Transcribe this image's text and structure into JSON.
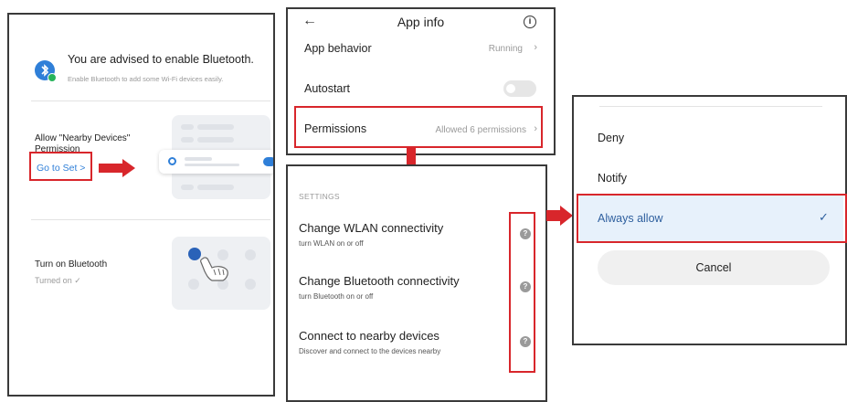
{
  "left_panel": {
    "prompt_title": "You are advised to enable Bluetooth.",
    "prompt_subtitle": "Enable Bluetooth to add some Wi-Fi devices easily.",
    "nearby_label": "Allow \"Nearby Devices\"",
    "nearby_sub": "Permission",
    "go_to_set": "Go to Set >",
    "bt_label": "Turn on Bluetooth",
    "bt_status": "Turned on ✓"
  },
  "app_info": {
    "title": "App info",
    "back_icon": "back-arrow-icon",
    "info_icon": "info-icon",
    "rows": [
      {
        "label": "App behavior",
        "value": "Running"
      },
      {
        "label": "Autostart",
        "value": ""
      },
      {
        "label": "Permissions",
        "value": "Allowed 6 permissions"
      }
    ]
  },
  "settings": {
    "header": "SETTINGS",
    "items": [
      {
        "title": "Change WLAN connectivity",
        "subtitle": "turn WLAN on or off"
      },
      {
        "title": "Change Bluetooth connectivity",
        "subtitle": "turn Bluetooth on or off"
      },
      {
        "title": "Connect to nearby devices",
        "subtitle": "Discover and connect to the devices nearby"
      }
    ]
  },
  "permission_dialog": {
    "options": [
      "Deny",
      "Notify",
      "Always allow"
    ],
    "selected": "Always allow",
    "cancel": "Cancel"
  },
  "colors": {
    "highlight_red": "#d8262b",
    "bluetooth_blue": "#2f7fd8",
    "selected_bg": "#e7f1fb",
    "selected_text": "#2e5f9e"
  }
}
